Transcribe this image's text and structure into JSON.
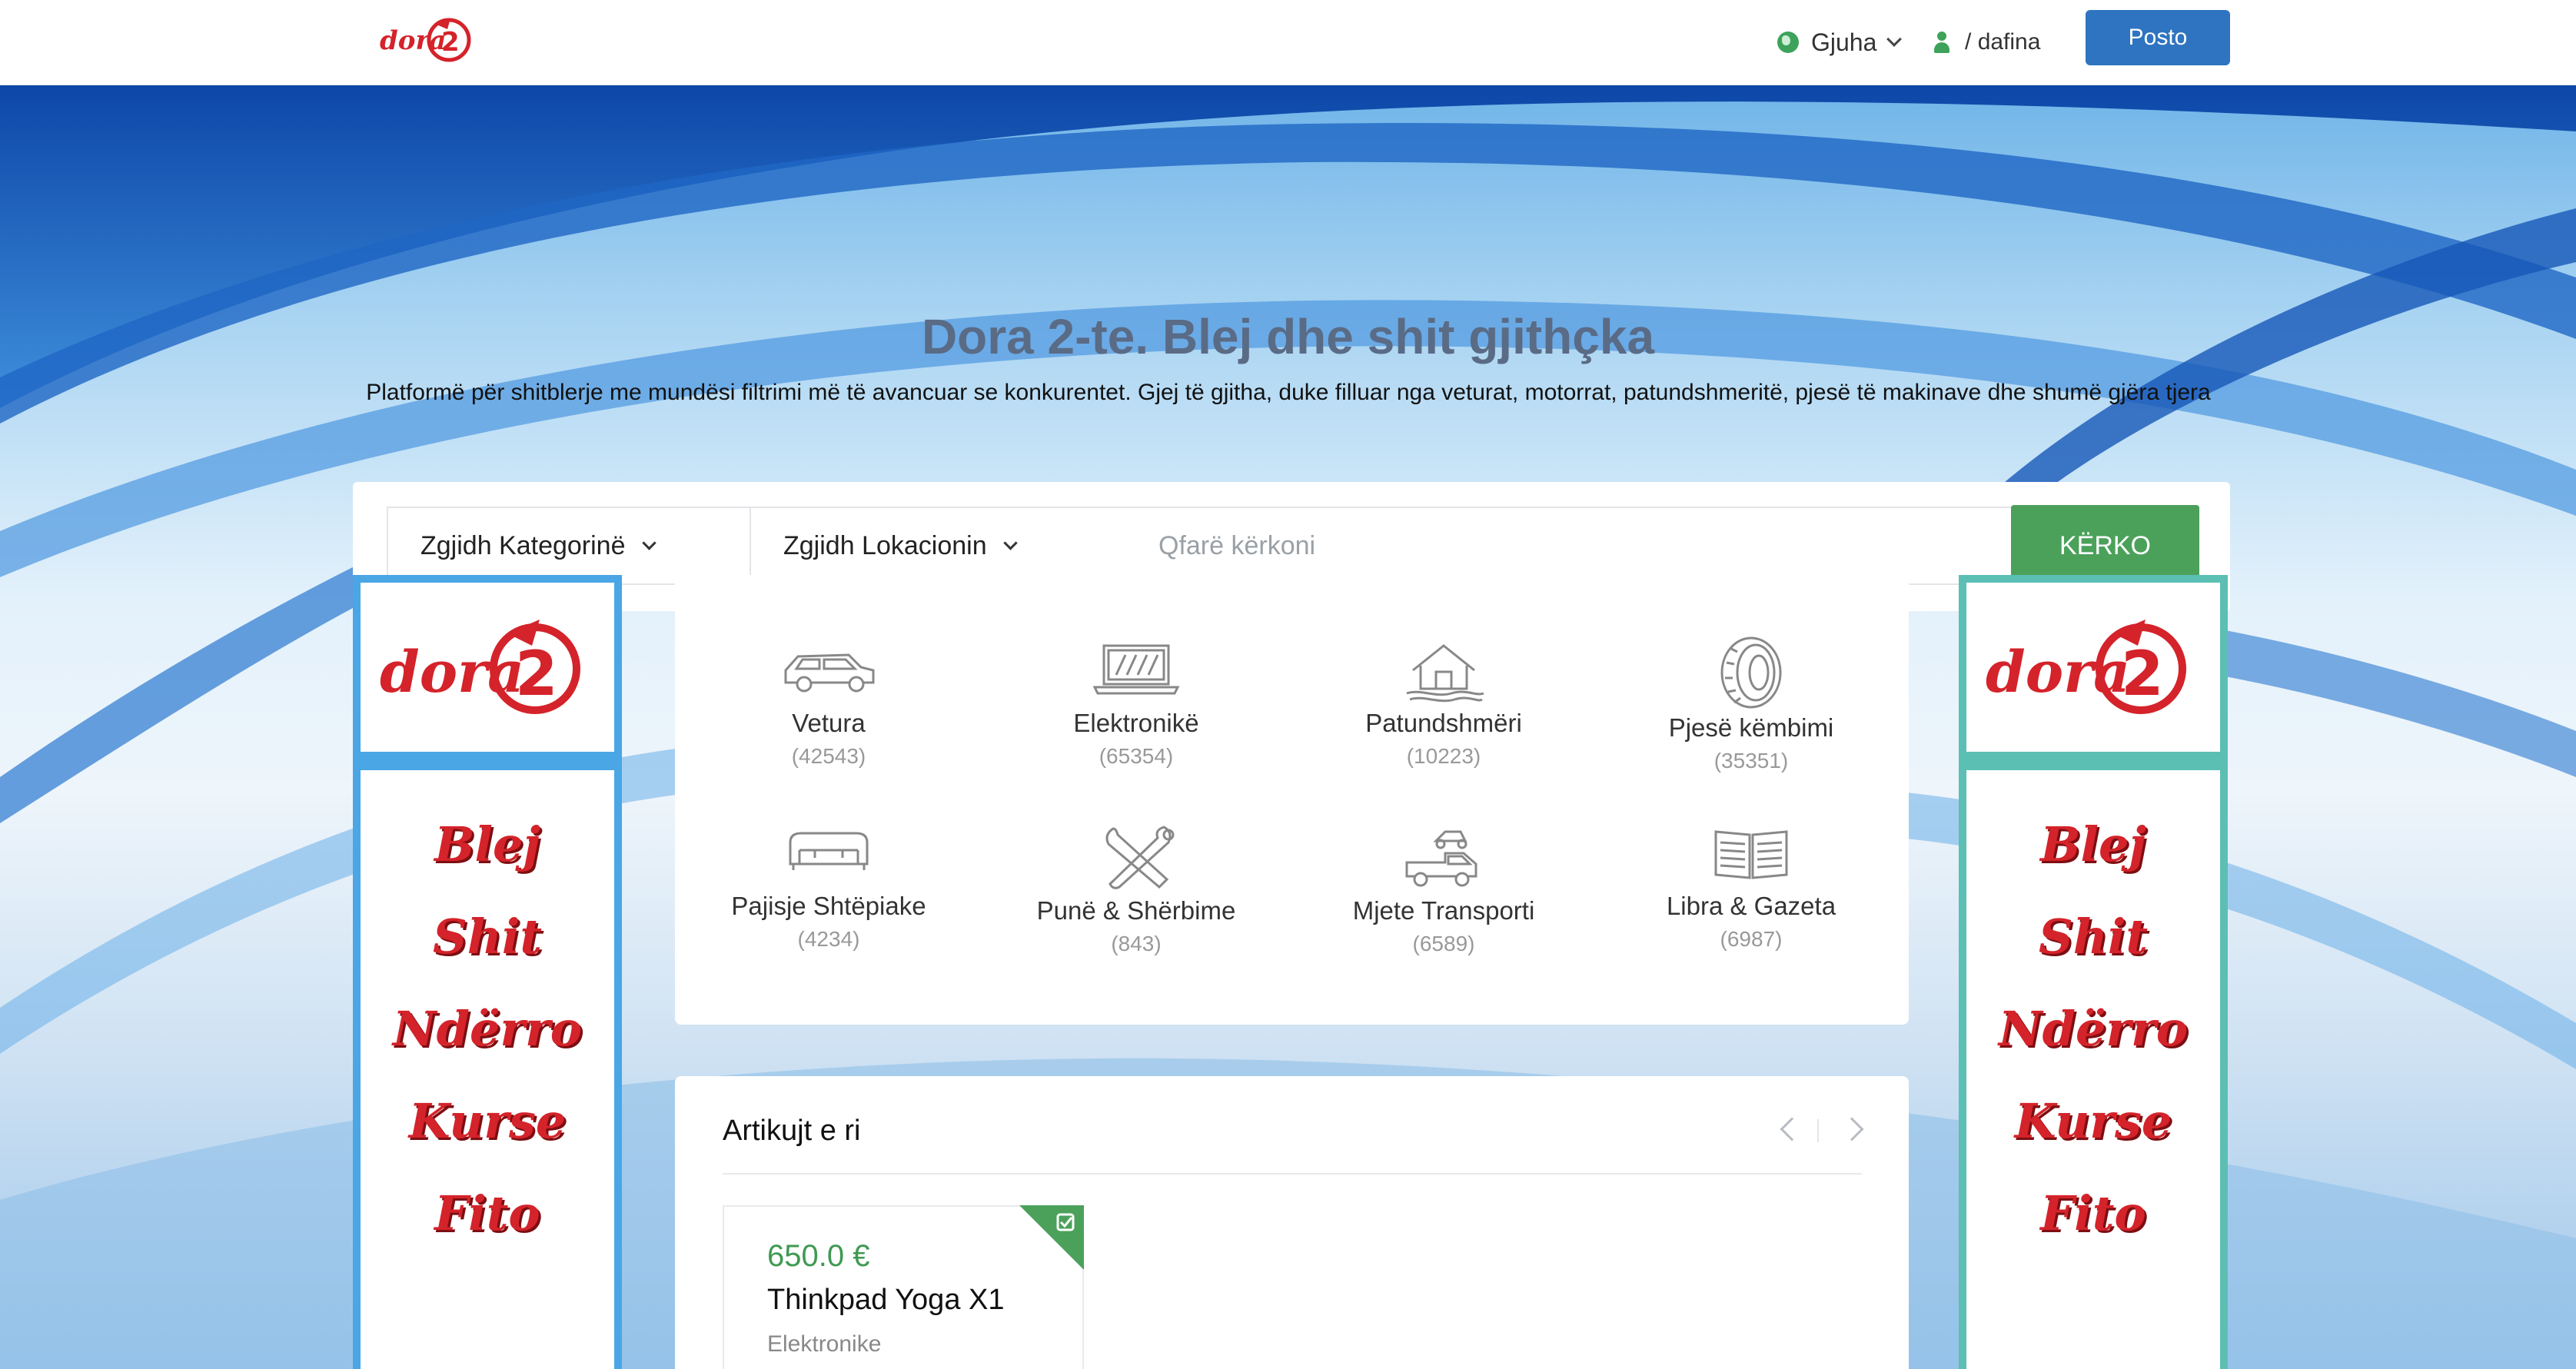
{
  "navbar": {
    "brand": "dora2",
    "language_label": "Gjuha",
    "user_separator": "/",
    "user_name": "dafina",
    "post_button": "Posto"
  },
  "hero": {
    "title": "Dora 2-te. Blej dhe shit gjithçka",
    "subtitle": "Platformë për shitblerje me mundësi filtrimi më të avancuar se konkurentet. Gjej të gjitha, duke filluar nga veturat, motorrat, patundshmeritë, pjesë të makinave dhe shumë gjëra tjera"
  },
  "search": {
    "category_select": "Zgjidh Kategorinë",
    "location_select": "Zgjidh Lokacionin",
    "placeholder": "Qfarë kërkoni",
    "button": "KËRKO"
  },
  "categories": [
    {
      "name": "Vetura",
      "count": "(42543)",
      "icon": "car-icon"
    },
    {
      "name": "Elektronikë",
      "count": "(65354)",
      "icon": "laptop-icon"
    },
    {
      "name": "Patundshmëri",
      "count": "(10223)",
      "icon": "house-icon"
    },
    {
      "name": "Pjesë këmbimi",
      "count": "(35351)",
      "icon": "tire-icon"
    },
    {
      "name": "Pajisje Shtëpiake",
      "count": "(4234)",
      "icon": "sofa-icon"
    },
    {
      "name": "Punë & Shërbime",
      "count": "(843)",
      "icon": "tools-icon"
    },
    {
      "name": "Mjete Transporti",
      "count": "(6589)",
      "icon": "truck-icon"
    },
    {
      "name": "Libra & Gazeta",
      "count": "(6987)",
      "icon": "book-icon"
    }
  ],
  "side_banner": {
    "logo": "dora2",
    "words": [
      "Blej",
      "Shit",
      "Ndërro",
      "Kurse",
      "Fito"
    ]
  },
  "new_items": {
    "title": "Artikujt e ri",
    "items": [
      {
        "price": "650.0 €",
        "title": "Thinkpad Yoga X1",
        "category": "Elektronike"
      }
    ]
  },
  "colors": {
    "brand_red": "#d4232a",
    "primary_blue": "#2e74c0",
    "search_green": "#4ba15a",
    "price_green": "#3f9a52"
  }
}
